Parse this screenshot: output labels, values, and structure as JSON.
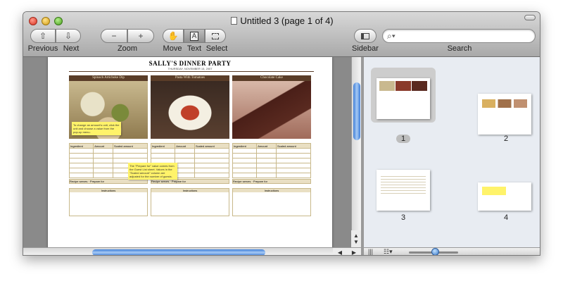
{
  "window": {
    "title": "Untitled 3 (page 1 of 4)"
  },
  "toolbar": {
    "previous_label": "Previous",
    "next_label": "Next",
    "zoom_label": "Zoom",
    "move_label": "Move",
    "text_label": "Text",
    "select_label": "Select",
    "sidebar_label": "Sidebar",
    "search_label": "Search",
    "search_placeholder": ""
  },
  "document": {
    "title": "SALLY'S DINNER PARTY",
    "date": "THURSDAY, NOVEMBER 15, 2007",
    "recipes": [
      {
        "name": "Spinach Artichoke Dip",
        "color": "#7a8a3a"
      },
      {
        "name": "Pasta With Tomatoes",
        "color": "#c0402a"
      },
      {
        "name": "Chocolate Cake",
        "color": "#5a2a20"
      }
    ],
    "table_header": [
      "Ingredient",
      "Amount",
      "Scaled amount"
    ],
    "recipe_serves_label": "Recipe serves",
    "prepare_for_label": "Prepare for",
    "instructions_label": "Instructions",
    "note_1": "To change an amount's unit, click the unit and choose a value from the pop-up menu.",
    "note_2": "The \"Prepare for\" value comes from the Guest List sheet. Values in the \"Scaled amount\" column are adjusted for the number of guests."
  },
  "sidebar": {
    "pages": [
      {
        "number": "1",
        "selected": true
      },
      {
        "number": "2",
        "selected": false
      },
      {
        "number": "3",
        "selected": false
      },
      {
        "number": "4",
        "selected": false
      }
    ],
    "zoom_fraction": 0.55
  },
  "colors": {
    "scroll_accent": "#3f7fd8",
    "header_brown": "#5a3d28"
  }
}
